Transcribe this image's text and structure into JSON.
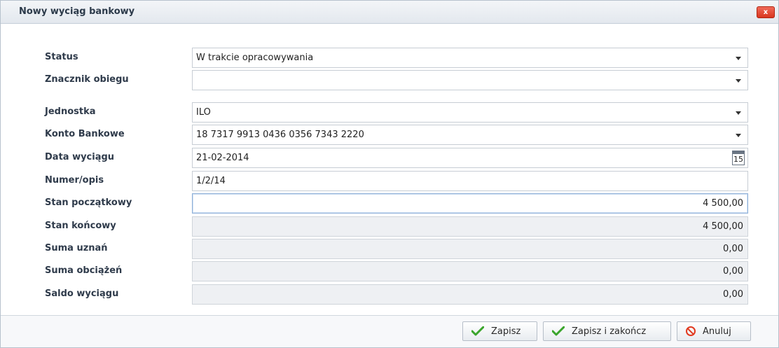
{
  "dialog": {
    "title": "Nowy wyciąg bankowy",
    "close_label": "x"
  },
  "form": {
    "status": {
      "label": "Status",
      "value": "W trakcie opracowywania"
    },
    "znacznik": {
      "label": "Znacznik obiegu",
      "value": ""
    },
    "jednostka": {
      "label": "Jednostka",
      "value": "ILO"
    },
    "konto": {
      "label": "Konto Bankowe",
      "value": "18 7317 9913 0436 0356 7343 2220"
    },
    "data": {
      "label": "Data wyciągu",
      "value": "21-02-2014",
      "calendar_day": "15"
    },
    "numer": {
      "label": "Numer/opis",
      "value": "1/2/14"
    },
    "stan_pocz": {
      "label": "Stan początkowy",
      "value": "4 500,00"
    },
    "stan_konc": {
      "label": "Stan końcowy",
      "value": "4 500,00"
    },
    "suma_uznan": {
      "label": "Suma uznań",
      "value": "0,00"
    },
    "suma_obc": {
      "label": "Suma obciążeń",
      "value": "0,00"
    },
    "saldo": {
      "label": "Saldo wyciągu",
      "value": "0,00"
    }
  },
  "footer": {
    "save_label": "Zapisz",
    "save_close_label": "Zapisz i zakończ",
    "cancel_label": "Anuluj"
  },
  "colors": {
    "accent_check": "#3aa52c",
    "cancel_red": "#e2391f",
    "close_red": "#d9361f"
  }
}
